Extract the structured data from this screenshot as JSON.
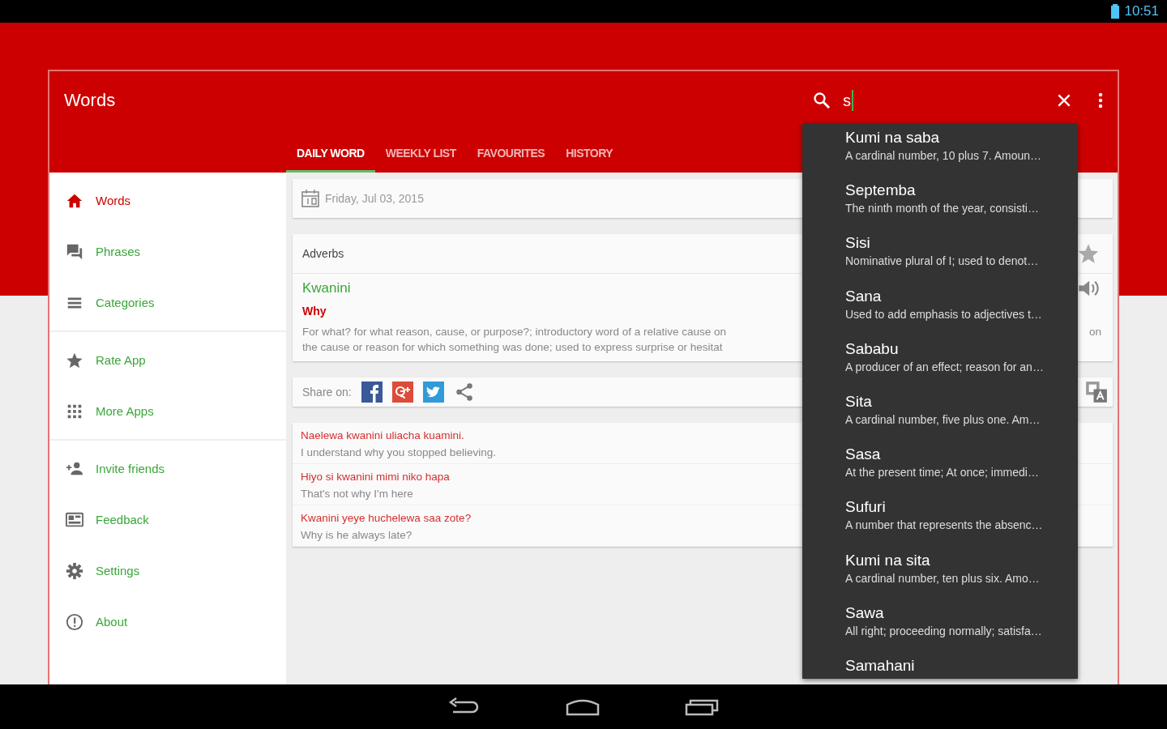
{
  "status_bar": {
    "time": "10:51"
  },
  "app_bar": {
    "title": "Words",
    "search": {
      "value": "s"
    }
  },
  "tabs": [
    {
      "label": "DAILY WORD",
      "selected": true
    },
    {
      "label": "WEEKLY LIST",
      "selected": false
    },
    {
      "label": "FAVOURITES",
      "selected": false
    },
    {
      "label": "HISTORY",
      "selected": false
    }
  ],
  "sidebar": {
    "groups": [
      {
        "items": [
          {
            "label": "Words",
            "selected": true
          },
          {
            "label": "Phrases",
            "selected": false
          },
          {
            "label": "Categories",
            "selected": false
          }
        ]
      },
      {
        "items": [
          {
            "label": "Rate App",
            "selected": false
          },
          {
            "label": "More Apps",
            "selected": false
          }
        ]
      },
      {
        "items": [
          {
            "label": "Invite friends",
            "selected": false
          },
          {
            "label": "Feedback",
            "selected": false
          },
          {
            "label": "Settings",
            "selected": false
          },
          {
            "label": "About",
            "selected": false
          }
        ]
      }
    ]
  },
  "date": "Friday, Jul 03, 2015",
  "word_card": {
    "category": "Adverbs",
    "word": "Kwanini",
    "translation": "Why",
    "description_lines": [
      "For what? for what reason, cause, or purpose?; introductory word of a relative cause on",
      "the cause or reason for which something was done; used to express surprise or hesitat"
    ],
    "description_tail": "on"
  },
  "share": {
    "label": "Share on:"
  },
  "examples": [
    {
      "swahili": "Naelewa kwanini uliacha kuamini.",
      "english": "I understand why you stopped believing."
    },
    {
      "swahili": "Hiyo si kwanini mimi niko hapa",
      "english": "That's not why I'm here"
    },
    {
      "swahili": "Kwanini yeye huchelewa saa zote?",
      "english": "Why is he always late?"
    }
  ],
  "suggestions": [
    {
      "title": "Kumi na saba",
      "subtitle": "A cardinal number, 10 plus 7. Amoun…"
    },
    {
      "title": "Septemba",
      "subtitle": "The ninth month of the year, consisti…"
    },
    {
      "title": "Sisi",
      "subtitle": "Nominative plural of I; used to denot…"
    },
    {
      "title": "Sana",
      "subtitle": "Used to add emphasis to adjectives t…"
    },
    {
      "title": "Sababu",
      "subtitle": "A producer of an effect; reason for an…"
    },
    {
      "title": "Sita",
      "subtitle": "A cardinal number, five plus one. Am…"
    },
    {
      "title": "Sasa",
      "subtitle": "At the present time; At once; immedi…"
    },
    {
      "title": "Sufuri",
      "subtitle": "A number that represents the absenc…"
    },
    {
      "title": "Kumi na sita",
      "subtitle": "A cardinal number, ten plus six. Amo…"
    },
    {
      "title": "Sawa",
      "subtitle": "All right; proceeding normally; satisfa…"
    },
    {
      "title": "Samahani"
    }
  ]
}
